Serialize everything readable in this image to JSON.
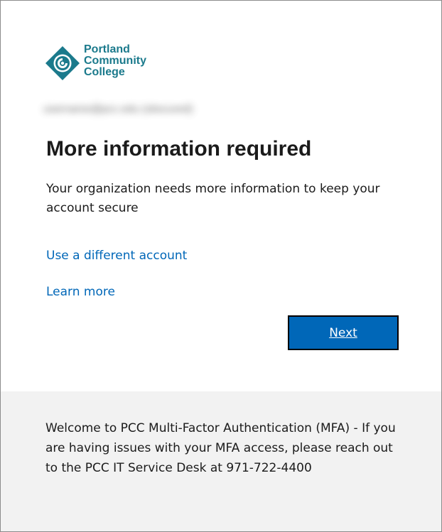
{
  "brand": {
    "line1": "Portland",
    "line2": "Community",
    "line3": "College",
    "color": "#1b7a8c"
  },
  "account": {
    "email": "username@pcc.edu (obscured)"
  },
  "main": {
    "title": "More information required",
    "description": "Your organization needs more information to keep your account secure",
    "use_different_account": "Use a different account",
    "learn_more": "Learn more",
    "next_label": "Next",
    "link_color": "#0067b8",
    "button_color": "#0067b8"
  },
  "footer": {
    "message": "Welcome to PCC Multi-Factor Authentication (MFA) - If you are having issues with your MFA access, please reach out to the PCC IT Service Desk at 971-722-4400",
    "background": "#f2f2f2"
  }
}
